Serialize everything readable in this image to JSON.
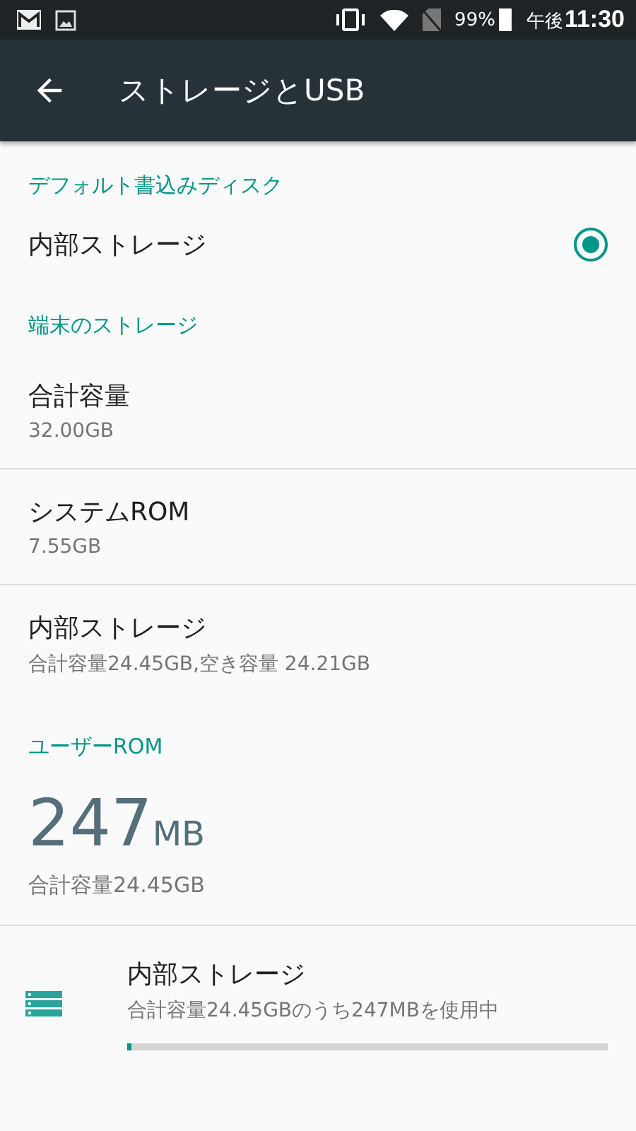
{
  "status_bar": {
    "battery": "99%",
    "time_prefix": "午後",
    "time": "11:30"
  },
  "app_bar": {
    "title": "ストレージとUSB"
  },
  "default_disk": {
    "header": "デフォルト書込みディスク",
    "options": [
      {
        "label": "内部ストレージ",
        "selected": true
      }
    ]
  },
  "device_storage": {
    "header": "端末のストレージ",
    "items": [
      {
        "title": "合計容量",
        "summary": "32.00GB"
      },
      {
        "title": "システムROM",
        "summary": "7.55GB"
      },
      {
        "title": "内部ストレージ",
        "summary": "合計容量24.45GB,空き容量 24.21GB"
      }
    ]
  },
  "user_rom": {
    "header": "ユーザーROM",
    "used_value": "247",
    "used_unit": "MB",
    "total": "合計容量24.45GB",
    "volume": {
      "title": "内部ストレージ",
      "summary": "合計容量24.45GBのうち247MBを使用中",
      "level": 0.01
    }
  }
}
